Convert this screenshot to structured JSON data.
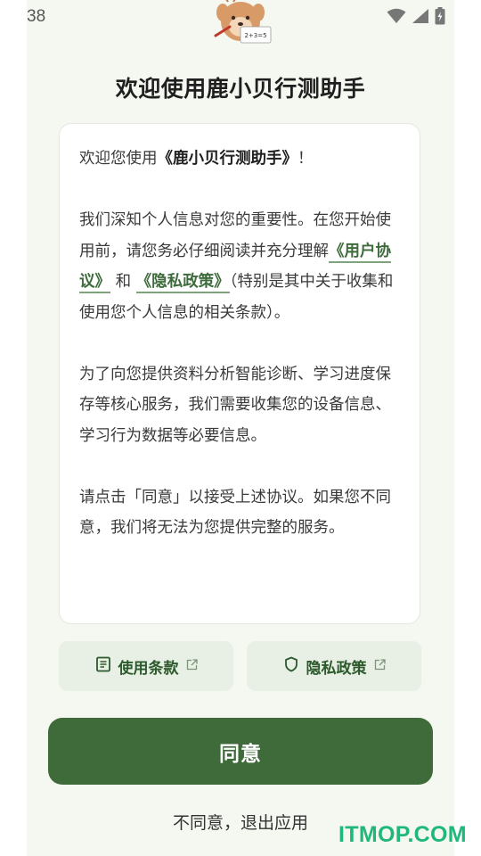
{
  "status_bar": {
    "time": "38"
  },
  "page": {
    "title": "欢迎使用鹿小贝行测助手"
  },
  "agreement": {
    "greeting_prefix": "欢迎您使用",
    "app_name": "《鹿小贝行测助手》",
    "greeting_suffix": "！",
    "p2_before": "我们深知个人信息对您的重要性。在您开始使用前，请您务必仔细阅读并充分理解",
    "user_agreement_link": "《用户协议》",
    "and": " 和 ",
    "privacy_policy_link": "《隐私政策》",
    "p2_after": "（特别是其中关于收集和使用您个人信息的相关条款）。",
    "p3": "为了向您提供资料分析智能诊断、学习进度保存等核心服务，我们需要收集您的设备信息、学习行为数据等必要信息。",
    "p4": "请点击「同意」以接受上述协议。如果您不同意，我们将无法为您提供完整的服务。"
  },
  "quick_links": {
    "terms_label": "使用条款",
    "privacy_label": "隐私政策"
  },
  "actions": {
    "agree_label": "同意",
    "decline_label": "不同意，退出应用"
  },
  "watermark": "ITMOP.COM",
  "colors": {
    "accent": "#3f6b3b",
    "link": "#3e6b3c",
    "background": "#f5f8f1",
    "watermark": "#1fb77a"
  }
}
